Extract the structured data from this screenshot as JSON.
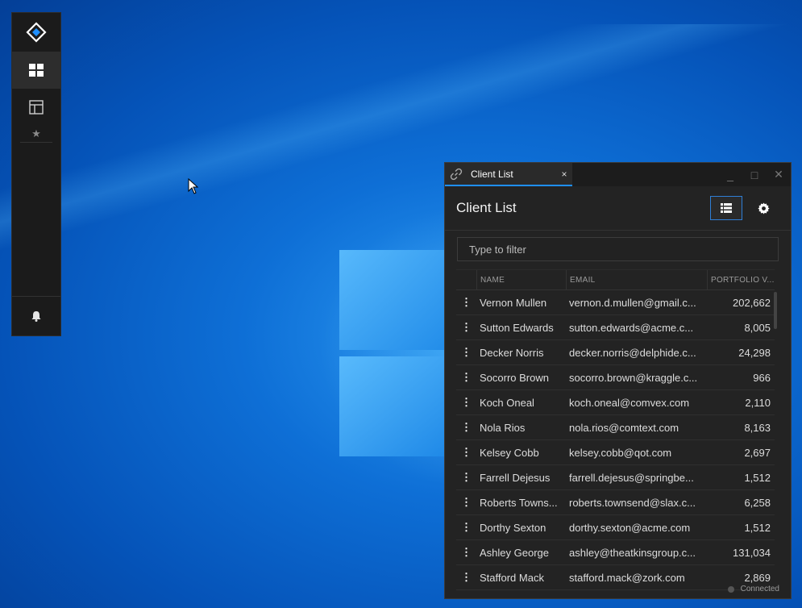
{
  "window": {
    "tab_title": "Client List",
    "tab_close": "×",
    "minimize": "_",
    "maximize": "□",
    "close": "✕"
  },
  "header": {
    "title": "Client List"
  },
  "filter": {
    "placeholder": "Type to filter"
  },
  "table": {
    "columns": [
      "NAME",
      "EMAIL",
      "PORTFOLIO V..."
    ],
    "rows": [
      {
        "name": "Vernon Mullen",
        "email": "vernon.d.mullen@gmail.c...",
        "value": "202,662"
      },
      {
        "name": "Sutton Edwards",
        "email": "sutton.edwards@acme.c...",
        "value": "8,005"
      },
      {
        "name": "Decker Norris",
        "email": "decker.norris@delphide.c...",
        "value": "24,298"
      },
      {
        "name": "Socorro Brown",
        "email": "socorro.brown@kraggle.c...",
        "value": "966"
      },
      {
        "name": "Koch Oneal",
        "email": "koch.oneal@comvex.com",
        "value": "2,110"
      },
      {
        "name": "Nola Rios",
        "email": "nola.rios@comtext.com",
        "value": "8,163"
      },
      {
        "name": "Kelsey Cobb",
        "email": "kelsey.cobb@qot.com",
        "value": "2,697"
      },
      {
        "name": "Farrell Dejesus",
        "email": "farrell.dejesus@springbe...",
        "value": "1,512"
      },
      {
        "name": "Roberts Towns...",
        "email": "roberts.townsend@slax.c...",
        "value": "6,258"
      },
      {
        "name": "Dorthy Sexton",
        "email": "dorthy.sexton@acme.com",
        "value": "1,512"
      },
      {
        "name": "Ashley George",
        "email": "ashley@theatkinsgroup.c...",
        "value": "131,034"
      },
      {
        "name": "Stafford Mack",
        "email": "stafford.mack@zork.com",
        "value": "2,869"
      }
    ]
  },
  "status": {
    "text": "Connected"
  },
  "sidebar": {
    "items": [
      "dashboard-icon",
      "layout-icon",
      "star-icon"
    ],
    "bottom": "bell-icon"
  }
}
